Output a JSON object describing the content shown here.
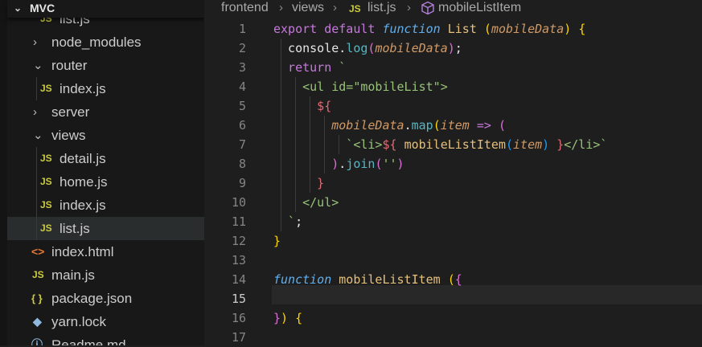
{
  "explorer": {
    "root": "MVC",
    "clipped_item": "list.js",
    "items": [
      {
        "label": "node_modules",
        "type": "folder",
        "expanded": false,
        "depth": 1
      },
      {
        "label": "router",
        "type": "folder",
        "expanded": true,
        "depth": 1
      },
      {
        "label": "index.js",
        "type": "js",
        "depth": 2
      },
      {
        "label": "server",
        "type": "folder",
        "expanded": false,
        "depth": 1
      },
      {
        "label": "views",
        "type": "folder",
        "expanded": true,
        "depth": 1
      },
      {
        "label": "detail.js",
        "type": "js",
        "depth": 2
      },
      {
        "label": "home.js",
        "type": "js",
        "depth": 2
      },
      {
        "label": "index.js",
        "type": "js",
        "depth": 2
      },
      {
        "label": "list.js",
        "type": "js",
        "depth": 2,
        "selected": true
      },
      {
        "label": "index.html",
        "type": "html",
        "depth": 1
      },
      {
        "label": "main.js",
        "type": "js",
        "depth": 1
      },
      {
        "label": "package.json",
        "type": "json",
        "depth": 1
      },
      {
        "label": "yarn.lock",
        "type": "yarn",
        "depth": 1
      },
      {
        "label": "Readme.md",
        "type": "info",
        "depth": 1
      }
    ]
  },
  "breadcrumb": {
    "parts": [
      "frontend",
      "views",
      "list.js",
      "mobileListItem"
    ],
    "js_badge": "JS",
    "symbol_icon": "cube-icon"
  },
  "editor": {
    "active_line": 15,
    "lines": [
      {
        "n": "1",
        "tokens": [
          [
            "kw",
            "export default "
          ],
          [
            "fn-kw",
            "function "
          ],
          [
            "func",
            "List "
          ],
          [
            "brace",
            "("
          ],
          [
            "param",
            "mobileData"
          ],
          [
            "brace",
            ")"
          ],
          [
            "plain",
            " "
          ],
          [
            "brace",
            "{"
          ]
        ]
      },
      {
        "n": "2",
        "tokens": [
          [
            "plain",
            "  console."
          ],
          [
            "method",
            "log"
          ],
          [
            "brace2",
            "("
          ],
          [
            "param",
            "mobileData"
          ],
          [
            "brace2",
            ")"
          ],
          [
            "plain",
            ";"
          ]
        ]
      },
      {
        "n": "3",
        "tokens": [
          [
            "kw",
            "  return "
          ],
          [
            "str",
            "`"
          ]
        ]
      },
      {
        "n": "4",
        "tokens": [
          [
            "str",
            "    <ul id=\"mobileList\">"
          ]
        ]
      },
      {
        "n": "5",
        "tokens": [
          [
            "tmpl",
            "      ${"
          ]
        ]
      },
      {
        "n": "6",
        "tokens": [
          [
            "param",
            "        mobileData"
          ],
          [
            "plain",
            "."
          ],
          [
            "method",
            "map"
          ],
          [
            "brace",
            "("
          ],
          [
            "param",
            "item"
          ],
          [
            "plain",
            " "
          ],
          [
            "kw",
            "=>"
          ],
          [
            "plain",
            " "
          ],
          [
            "brace2",
            "("
          ]
        ]
      },
      {
        "n": "7",
        "tokens": [
          [
            "str",
            "          `<li>"
          ],
          [
            "tmpl",
            "${"
          ],
          [
            "plain",
            " "
          ],
          [
            "func",
            "mobileListItem"
          ],
          [
            "brace3",
            "("
          ],
          [
            "param",
            "item"
          ],
          [
            "brace3",
            ")"
          ],
          [
            "plain",
            " "
          ],
          [
            "tmpl",
            "}"
          ],
          [
            "str",
            "</li>`"
          ]
        ]
      },
      {
        "n": "8",
        "tokens": [
          [
            "brace2",
            "        )"
          ],
          [
            "plain",
            "."
          ],
          [
            "method",
            "join"
          ],
          [
            "brace2",
            "("
          ],
          [
            "str",
            "''"
          ],
          [
            "brace2",
            ")"
          ]
        ]
      },
      {
        "n": "9",
        "tokens": [
          [
            "tmpl",
            "      }"
          ]
        ]
      },
      {
        "n": "10",
        "tokens": [
          [
            "str",
            "    </ul>"
          ]
        ]
      },
      {
        "n": "11",
        "tokens": [
          [
            "str",
            "  `"
          ],
          [
            "plain",
            ";"
          ]
        ]
      },
      {
        "n": "12",
        "tokens": [
          [
            "brace",
            "}"
          ]
        ]
      },
      {
        "n": "13",
        "tokens": []
      },
      {
        "n": "14",
        "tokens": [
          [
            "fn-kw",
            "function "
          ],
          [
            "func",
            "mobileListItem "
          ],
          [
            "brace",
            "("
          ],
          [
            "brace2",
            "{"
          ]
        ]
      },
      {
        "n": "15",
        "tokens": []
      },
      {
        "n": "16",
        "tokens": [
          [
            "brace2",
            "}"
          ],
          [
            "brace",
            ")"
          ],
          [
            "plain",
            " "
          ],
          [
            "brace",
            "{"
          ]
        ]
      },
      {
        "n": "17",
        "tokens": []
      }
    ]
  },
  "colors": {
    "background": "#1e1e1e",
    "sidebar": "#181818",
    "selected_row": "#2a2d2e",
    "js_icon": "#cbcb41",
    "keyword": "#c678dd",
    "function_keyword": "#61afef"
  }
}
